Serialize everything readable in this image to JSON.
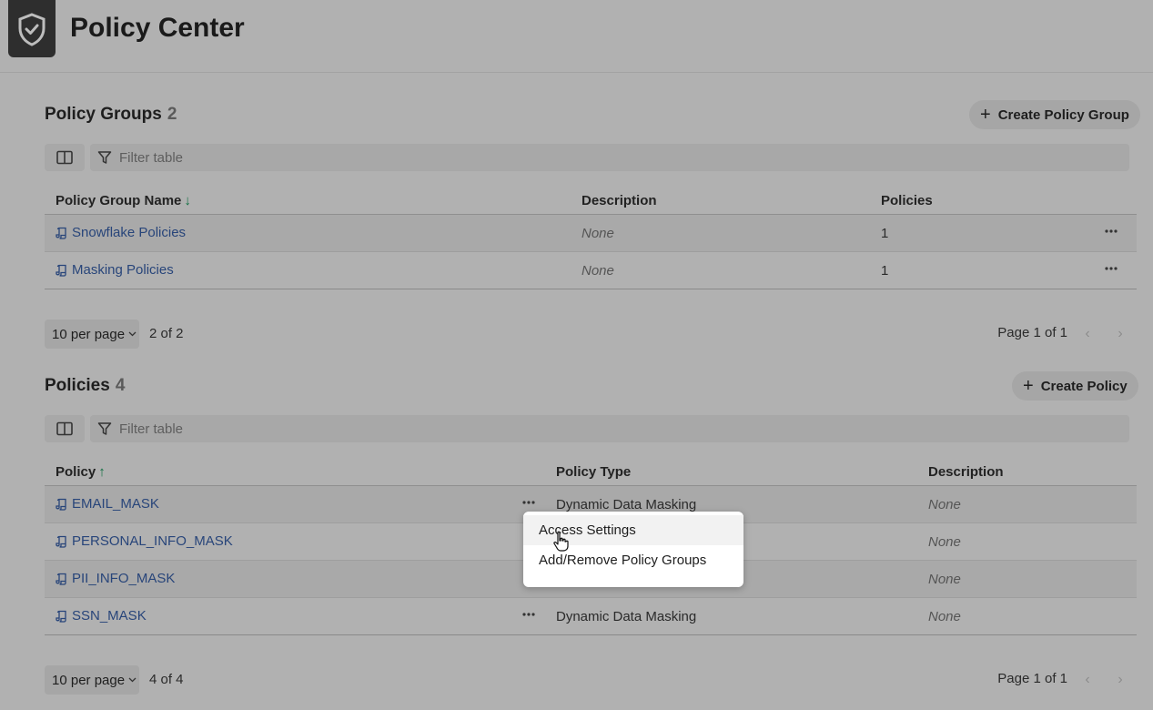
{
  "header": {
    "title": "Policy Center",
    "logo_icon": "shield-check-icon"
  },
  "policy_groups": {
    "title": "Policy Groups",
    "count": "2",
    "create_label": "Create Policy Group",
    "filter_placeholder": "Filter table",
    "columns": [
      "Policy Group Name",
      "Description",
      "Policies"
    ],
    "rows": [
      {
        "name": "Snowflake Policies",
        "description": "None",
        "policies": "1"
      },
      {
        "name": "Masking Policies",
        "description": "None",
        "policies": "1"
      }
    ],
    "per_page": "10 per page",
    "range": "2 of 2",
    "page_label": "Page 1 of 1"
  },
  "policies": {
    "title": "Policies",
    "count": "4",
    "create_label": "Create Policy",
    "filter_placeholder": "Filter table",
    "columns": [
      "Policy",
      "Policy Type",
      "Description"
    ],
    "rows": [
      {
        "name": "EMAIL_MASK",
        "type": "Dynamic Data Masking",
        "description": "None"
      },
      {
        "name": "PERSONAL_INFO_MASK",
        "type": "",
        "description": "None"
      },
      {
        "name": "PII_INFO_MASK",
        "type": "",
        "description": "None"
      },
      {
        "name": "SSN_MASK",
        "type": "Dynamic Data Masking",
        "description": "None"
      }
    ],
    "per_page": "10 per page",
    "range": "4 of 4",
    "page_label": "Page 1 of 1"
  },
  "context_menu": {
    "items": [
      "Access Settings",
      "Add/Remove Policy Groups"
    ]
  },
  "colors": {
    "background": "#b1b1b1",
    "link": "#28457a",
    "sort_indicator": "#0f6f41",
    "menu_bg": "#ffffff"
  }
}
